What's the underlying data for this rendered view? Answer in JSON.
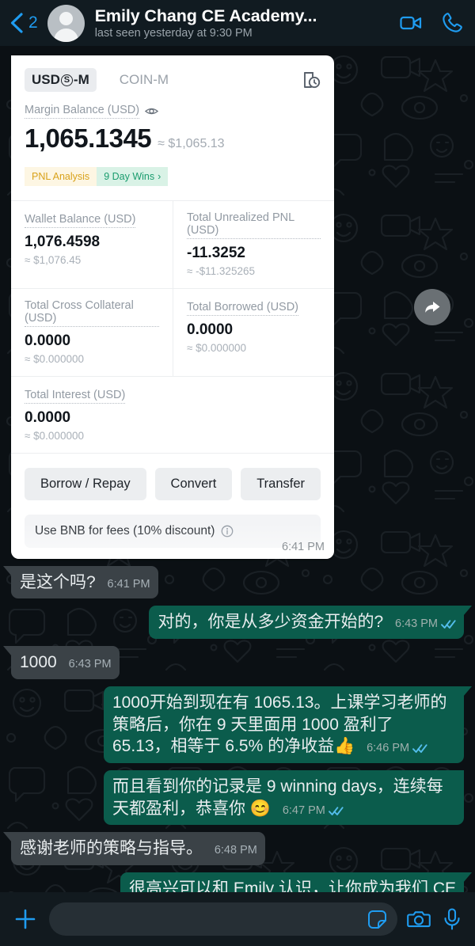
{
  "header": {
    "back_count": "2",
    "title": "Emily Chang CE Academy...",
    "status": "last seen yesterday at 9:30 PM",
    "back_icon": "chevron-left-icon",
    "avatar_icon": "contact-avatar",
    "video_icon": "video-call-icon",
    "call_icon": "voice-call-icon"
  },
  "card": {
    "tab_usds": "USDⓈ-M",
    "tab_usds_prefix": "USD",
    "tab_usds_mark": "S",
    "tab_usds_suffix": "-M",
    "tab_coin": "COIN-M",
    "history_icon": "order-history-icon",
    "margin_label": "Margin Balance (USD)",
    "eye_icon": "eye-visibility-icon",
    "margin_value": "1,065.1345",
    "margin_approx": "≈ $1,065.13",
    "badge_pnl": "PNL Analysis",
    "badge_wins": "9 Day Wins",
    "badge_wins_chevron": "›",
    "stats": [
      {
        "label": "Wallet Balance (USD)",
        "value": "1,076.4598",
        "sub": "≈ $1,076.45"
      },
      {
        "label": "Total Unrealized PNL (USD)",
        "value": "-11.3252",
        "sub": "≈ -$11.325265"
      },
      {
        "label": "Total Cross Collateral (USD)",
        "value": "0.0000",
        "sub": "≈ $0.000000"
      },
      {
        "label": "Total Borrowed (USD)",
        "value": "0.0000",
        "sub": "≈ $0.000000"
      },
      {
        "label": "Total Interest (USD)",
        "value": "0.0000",
        "sub": "≈ $0.000000"
      }
    ],
    "buttons": [
      "Borrow / Repay",
      "Convert",
      "Transfer"
    ],
    "bnb_text": "Use BNB for fees (10% discount)",
    "bnb_info_icon": "info-circle-icon",
    "timestamp": "6:41 PM",
    "forward_icon": "forward-arrow-icon"
  },
  "messages": [
    {
      "dir": "in",
      "text": "是这个吗?",
      "time": "6:41 PM",
      "ticks": false
    },
    {
      "dir": "out",
      "text": "对的，你是从多少资金开始的?",
      "time": "6:43 PM",
      "ticks": true
    },
    {
      "dir": "in",
      "text": "1000",
      "time": "6:43 PM",
      "ticks": false
    },
    {
      "dir": "out",
      "text": "1000开始到现在有 1065.13。上课学习老师的策略后，你在 9 天里面用 1000 盈利了 65.13，相等于 6.5% 的净收益",
      "emoji": "👍",
      "time": "6:46 PM",
      "ticks": true
    },
    {
      "dir": "out",
      "text": "而且看到你的记录是 9 winning days，连续每天都盈利，恭喜你",
      "emoji": "😊",
      "time": "6:47 PM",
      "ticks": true
    },
    {
      "dir": "in",
      "text": "感谢老师的策略与指导。",
      "time": "6:48 PM",
      "ticks": false
    },
    {
      "dir": "out",
      "text": "很高兴可以和 Emily 认识，让你成为我们 CE",
      "time": "",
      "ticks": false,
      "clipped": true
    }
  ],
  "footer": {
    "plus_icon": "plus-attach-icon",
    "input_value": "",
    "input_placeholder": "",
    "sticker_icon": "sticker-icon",
    "camera_icon": "camera-icon",
    "mic_icon": "microphone-icon"
  },
  "colors": {
    "accent_blue": "#1f9cf0",
    "bubble_out": "#0b5c4c",
    "bubble_in": "#3b4247",
    "chat_bg": "#0b1014",
    "header_bg": "#111b21",
    "tick_blue": "#53bdeb"
  }
}
